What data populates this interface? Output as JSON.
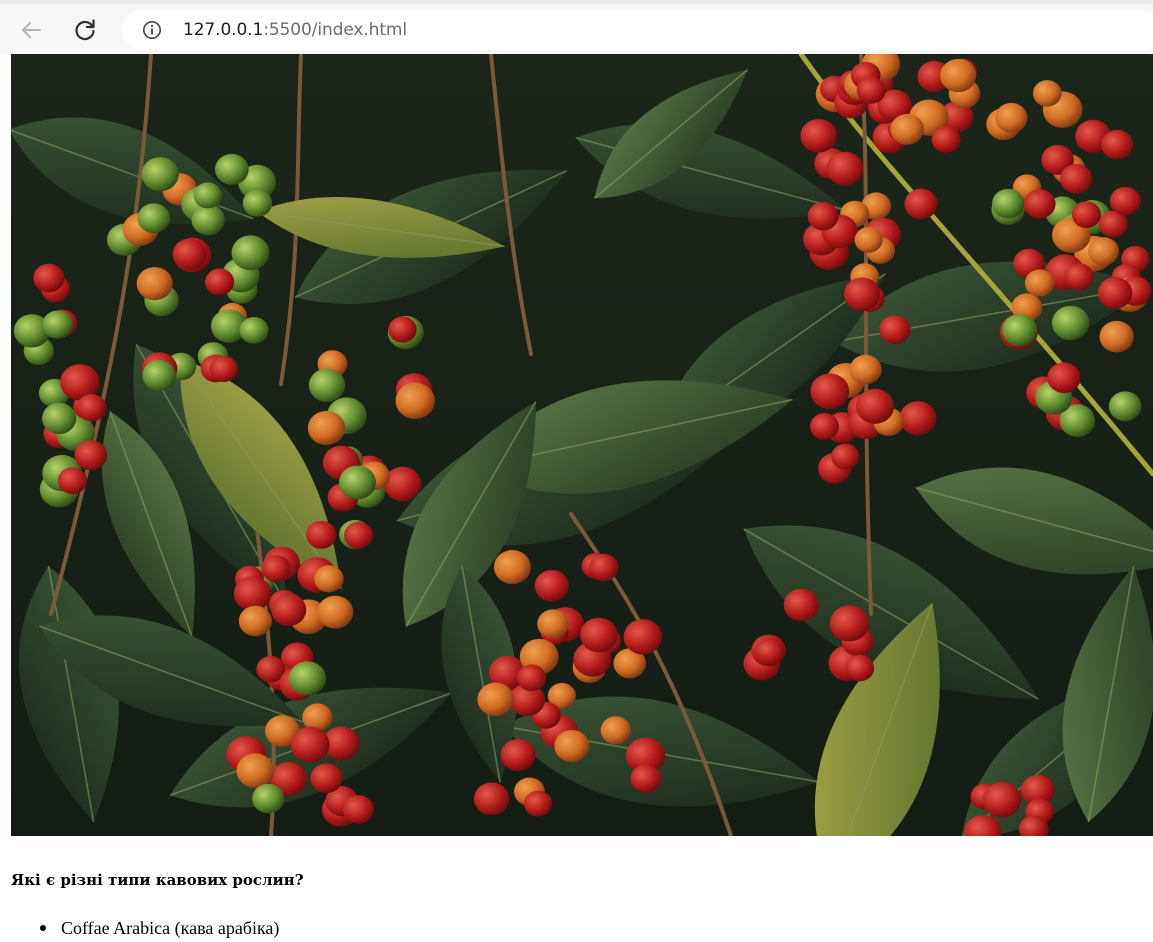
{
  "browser": {
    "url_host": "127.0.0.1",
    "url_rest": ":5500/index.html",
    "icons": {
      "back": "back-arrow-icon",
      "reload": "reload-icon",
      "site_info": "info-icon"
    }
  },
  "page": {
    "image": {
      "subject": "coffee-plant-photo",
      "colors": {
        "leaf_dark": "#1e3020",
        "berry_red": "#b41c1c",
        "berry_green": "#5f8a2e"
      }
    },
    "question": "Які є різні типи кавових рослин?",
    "plant_types": [
      "Coffae Arabica (кава арабіка)"
    ]
  }
}
